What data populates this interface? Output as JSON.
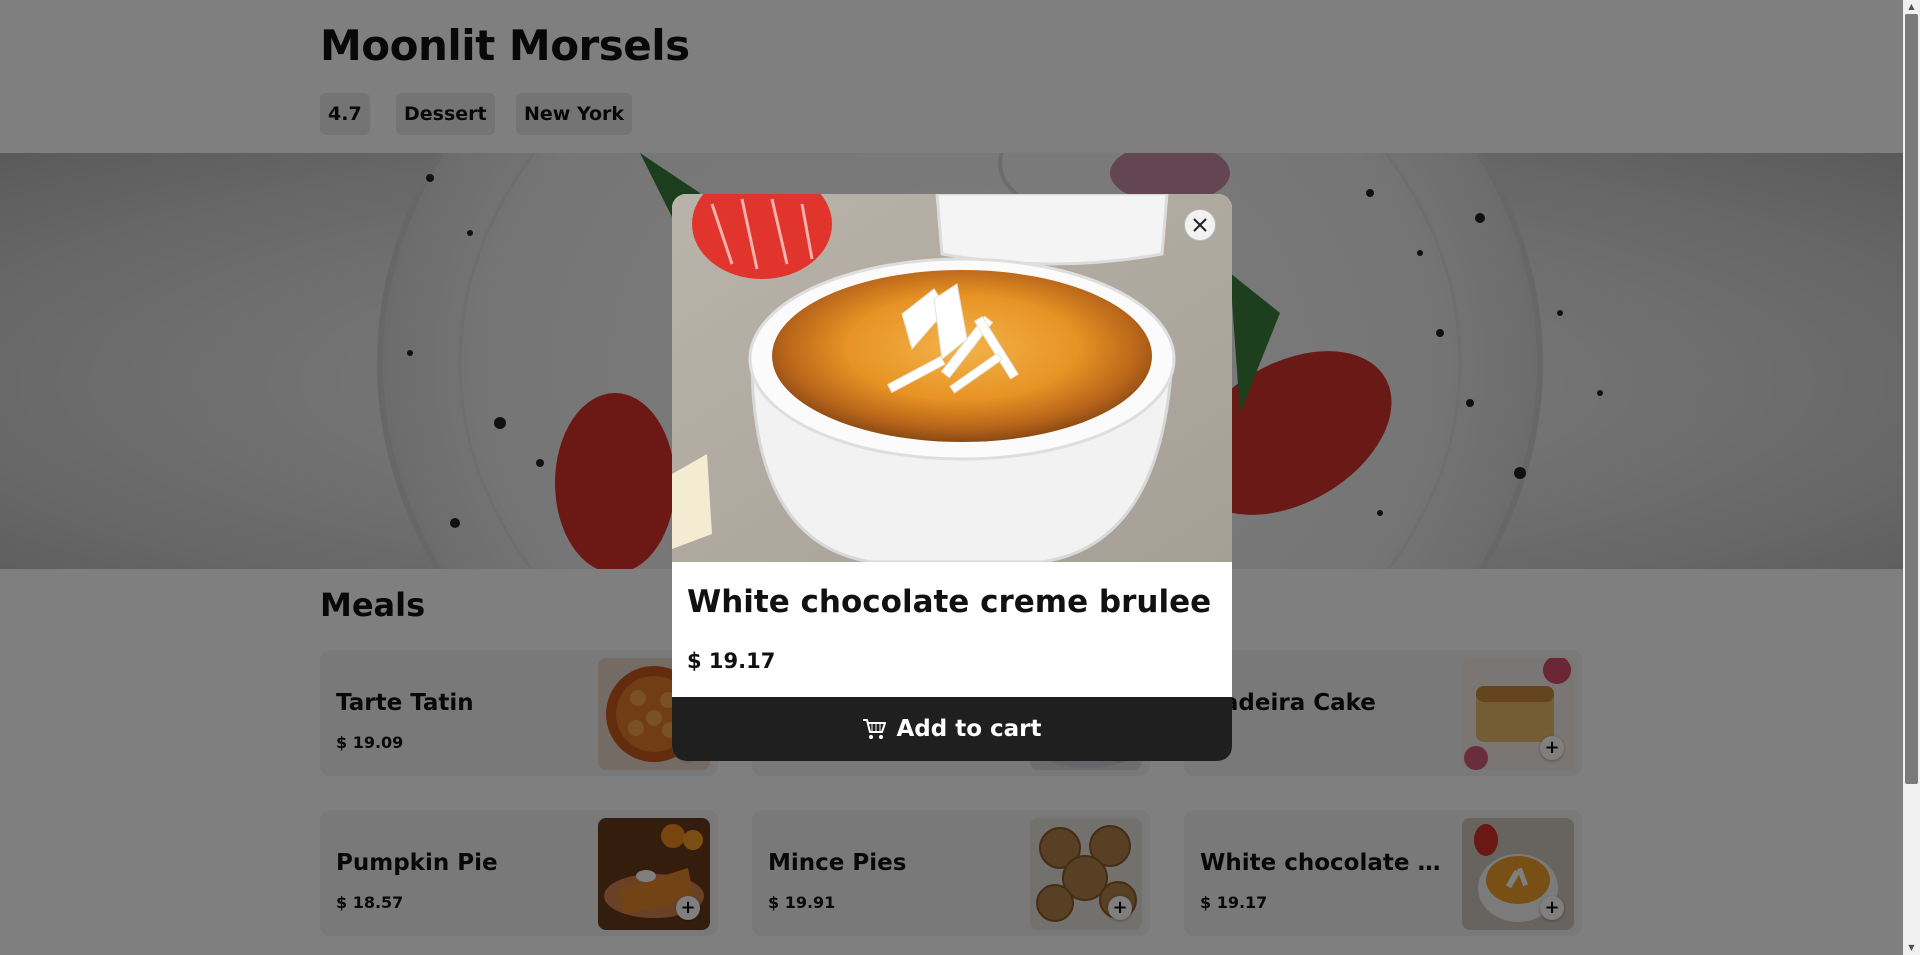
{
  "restaurant": {
    "name": "Moonlit Morsels",
    "rating": "4.7",
    "category": "Dessert",
    "location": "New York"
  },
  "menu": {
    "section_title": "Meals",
    "items": [
      {
        "name": "Tarte Tatin",
        "price": "$ 19.09",
        "add_label": "+"
      },
      {
        "name": "",
        "price": "",
        "add_label": "+"
      },
      {
        "name": "Madeira Cake",
        "price": "",
        "add_label": "+"
      },
      {
        "name": "Pumpkin Pie",
        "price": "$ 18.57",
        "add_label": "+"
      },
      {
        "name": "Mince Pies",
        "price": "$ 19.91",
        "add_label": "+"
      },
      {
        "name": "White chocolate creme brulee",
        "price": "$ 19.17",
        "add_label": "+"
      }
    ]
  },
  "modal": {
    "title": "White chocolate creme brulee",
    "price": "$ 19.17",
    "cart_label": "Add to cart",
    "close_icon": "close-icon",
    "cart_icon": "shopping-cart-icon"
  },
  "colors": {
    "overlay": "rgba(0,0,0,0.5)",
    "cart_button": "#1f1f1f",
    "chip_bg": "#e8e8e8",
    "card_bg": "#f2f2f2"
  }
}
